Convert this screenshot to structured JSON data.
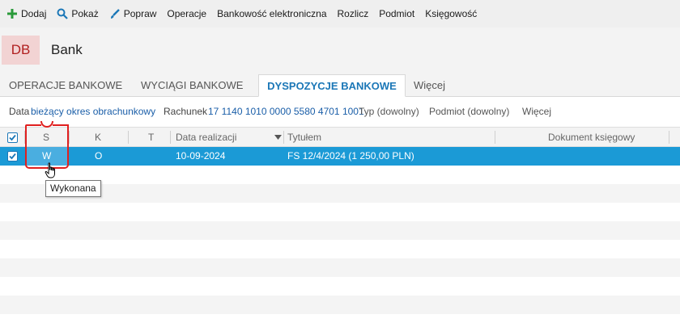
{
  "toolbar": {
    "add": "Dodaj",
    "show": "Pokaż",
    "edit": "Popraw",
    "operations": "Operacje",
    "ebanking": "Bankowość elektroniczna",
    "settle": "Rozlicz",
    "subject": "Podmiot",
    "accounting": "Księgowość"
  },
  "module": {
    "badge": "DB",
    "title": "Bank"
  },
  "tabs": [
    {
      "label": "OPERACJE BANKOWE",
      "active": false
    },
    {
      "label": "WYCIĄGI BANKOWE",
      "active": false
    },
    {
      "label": "DYSPOZYCJE BANKOWE",
      "active": true
    },
    {
      "label": "Więcej",
      "active": false
    }
  ],
  "filters": {
    "date_label": "Data",
    "date_value": "bieżący okres obrachunkowy",
    "account_label": "Rachunek",
    "account_value": "17 1140 1010 0000 5580 4701 1001",
    "type": "Typ (dowolny)",
    "subject": "Podmiot (dowolny)",
    "more": "Więcej"
  },
  "grid": {
    "columns": {
      "status": "S",
      "k": "K",
      "t": "T",
      "date": "Data realizacji",
      "title": "Tytułem",
      "doc": "Dokument księgowy"
    },
    "rows": [
      {
        "checked": true,
        "status": "W",
        "k": "O",
        "t": "",
        "date": "10-09-2024",
        "title": "FS 12/4/2024 (1 250,00 PLN)",
        "doc": ""
      }
    ]
  },
  "tooltip": "Wykonana",
  "colors": {
    "accent": "#1b77b7",
    "selected_row": "#1b9ad6",
    "badge_bg": "#f2d3d3",
    "badge_text": "#b01f1f",
    "annotation": "#e0201f"
  }
}
